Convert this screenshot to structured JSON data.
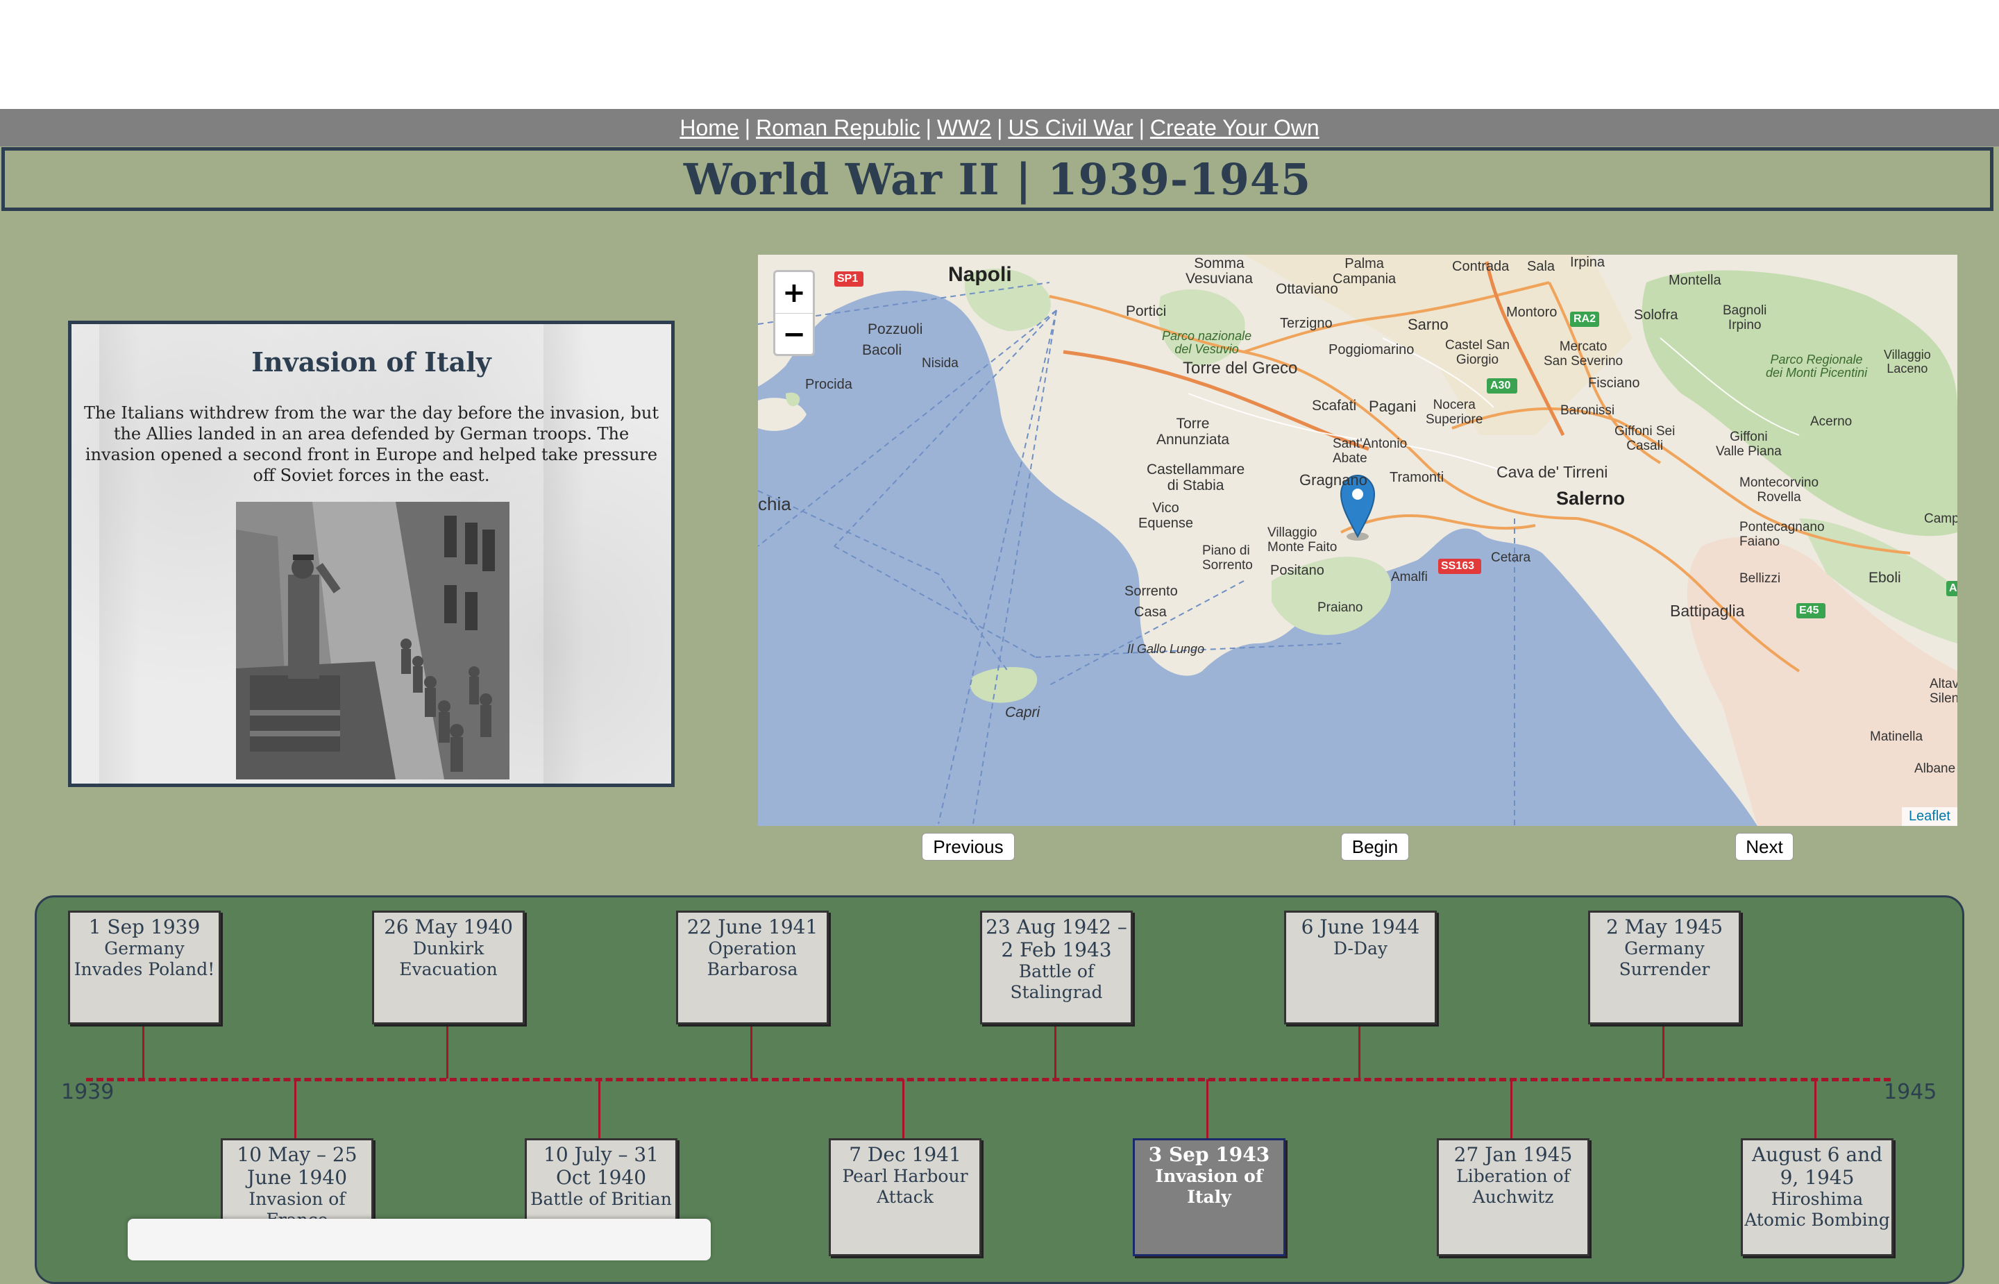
{
  "nav": {
    "links": [
      "Home",
      "Roman Republic",
      "WW2",
      "US Civil War",
      "Create Your Own"
    ],
    "separator": "|"
  },
  "title": "World War II | 1939-1945",
  "info": {
    "heading": "Invasion of Italy",
    "body": "The Italians withdrew from the war the day before the invasion, but the Allies landed in an area defended by German troops. The invasion opened a second front in Europe and helped take pressure off Soviet forces in the east."
  },
  "map": {
    "zoom_in": "+",
    "zoom_out": "−",
    "attribution": "Leaflet",
    "labels": {
      "napoli": "Napoli",
      "somma": "Somma\nVesuviana",
      "ottaviano": "Ottaviano",
      "palma": "Palma\nCampania",
      "contrada": "Contrada",
      "sala": "Sala",
      "irpina": "Irpina",
      "montella": "Montella",
      "pozzuoli": "Pozzuoli",
      "bacoli": "Bacoli",
      "nisida": "Nisida",
      "procida": "Procida",
      "portici": "Portici",
      "terzigno": "Terzigno",
      "sarno": "Sarno",
      "montoro": "Montoro",
      "solofra": "Solofra",
      "bagnoli": "Bagnoli\nIrpino",
      "vesuvio": "Parco nazionale\ndel Vesuvio",
      "torre_greco": "Torre del Greco",
      "poggiomarino": "Poggiomarino",
      "castel": "Castel San\nGiorgio",
      "mercato": "Mercato\nSan Severino",
      "villaggio": "Villaggio\nLaceno",
      "picentini": "Parco Regionale\ndei Monti Picentini",
      "fisciano": "Fisciano",
      "scafati": "Scafati",
      "pagani": "Pagani",
      "nocera": "Nocera\nSuperiore",
      "baronissi": "Baronissi",
      "torre_ann": "Torre\nAnnunziata",
      "sant_antonio": "Sant'Antonio\nAbate",
      "giffoni_sei": "Giffoni Sei\nCasali",
      "giffoni_valle": "Giffoni\nValle Piana",
      "acerno": "Acerno",
      "chia": "chia",
      "castellammare": "Castellammare\ndi Stabia",
      "gragnano": "Gragnano",
      "tramonti": "Tramonti",
      "cava": "Cava de' Tirreni",
      "salerno": "Salerno",
      "montecorvino": "Montecorvino\nRovella",
      "vico": "Vico\nEquense",
      "villaggio_faito": "Villaggio\nMonte Faito",
      "piano": "Piano di\nSorrento",
      "positano": "Positano",
      "amalfi": "Amalfi",
      "cetara": "Cetara",
      "pontecagnano": "Pontecagnano\nFaiano",
      "campag": "Campag",
      "sorrento": "Sorrento",
      "casa": "Casa",
      "praiano": "Praiano",
      "bellizzi": "Bellizzi",
      "eboli": "Eboli",
      "battipaglia": "Battipaglia",
      "gallo": "Il Gallo Lungo",
      "capri": "Capri",
      "matinella": "Matinella",
      "altav": "Altav\nSilen",
      "albane": "Albane",
      "road_sp1": "SP1",
      "road_ra2": "RA2",
      "road_a30": "A30",
      "road_ss163": "SS163",
      "road_e45": "E45",
      "road_a": "A"
    }
  },
  "controls": {
    "previous": "Previous",
    "begin": "Begin",
    "next": "Next"
  },
  "timeline": {
    "start_year": "1939",
    "end_year": "1945",
    "top_events": [
      {
        "date": "1 Sep 1939",
        "title": "Germany Invades Poland!"
      },
      {
        "date": "26 May 1940",
        "title": "Dunkirk Evacuation"
      },
      {
        "date": "22 June 1941",
        "title": "Operation Barbarosa"
      },
      {
        "date": "23 Aug 1942 – 2 Feb 1943",
        "title": "Battle of Stalingrad"
      },
      {
        "date": "6 June 1944",
        "title": "D-Day"
      },
      {
        "date": "2 May 1945",
        "title": "Germany Surrender"
      }
    ],
    "bottom_events": [
      {
        "date": "10 May – 25 June 1940",
        "title": "Invasion of France"
      },
      {
        "date": "10 July – 31 Oct 1940",
        "title": "Battle of Britian"
      },
      {
        "date": "7 Dec 1941",
        "title": "Pearl Harbour Attack"
      },
      {
        "date": "3 Sep 1943",
        "title": "Invasion of Italy",
        "active": true
      },
      {
        "date": "27 Jan 1945",
        "title": "Liberation of Auchwitz"
      },
      {
        "date": "August 6 and 9, 1945",
        "title": "Hiroshima Atomic Bombing"
      }
    ]
  },
  "colors": {
    "page_bg": "#a1ae89",
    "nav_bg": "#808080",
    "title_text": "#2c3e50",
    "timeline_bg": "#5a8058",
    "timeline_line": "#a6142b",
    "event_card": "#d8d6d0",
    "active_card": "#808080"
  }
}
